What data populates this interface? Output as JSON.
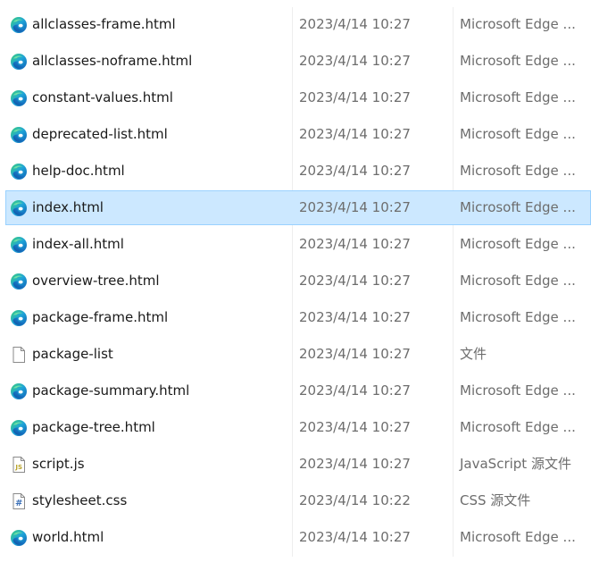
{
  "files": [
    {
      "name": "allclasses-frame.html",
      "modified": "2023/4/14 10:27",
      "type": "Microsoft Edge ...",
      "icon": "edge-icon",
      "selected": false
    },
    {
      "name": "allclasses-noframe.html",
      "modified": "2023/4/14 10:27",
      "type": "Microsoft Edge ...",
      "icon": "edge-icon",
      "selected": false
    },
    {
      "name": "constant-values.html",
      "modified": "2023/4/14 10:27",
      "type": "Microsoft Edge ...",
      "icon": "edge-icon",
      "selected": false
    },
    {
      "name": "deprecated-list.html",
      "modified": "2023/4/14 10:27",
      "type": "Microsoft Edge ...",
      "icon": "edge-icon",
      "selected": false
    },
    {
      "name": "help-doc.html",
      "modified": "2023/4/14 10:27",
      "type": "Microsoft Edge ...",
      "icon": "edge-icon",
      "selected": false
    },
    {
      "name": "index.html",
      "modified": "2023/4/14 10:27",
      "type": "Microsoft Edge ...",
      "icon": "edge-icon",
      "selected": true
    },
    {
      "name": "index-all.html",
      "modified": "2023/4/14 10:27",
      "type": "Microsoft Edge ...",
      "icon": "edge-icon",
      "selected": false
    },
    {
      "name": "overview-tree.html",
      "modified": "2023/4/14 10:27",
      "type": "Microsoft Edge ...",
      "icon": "edge-icon",
      "selected": false
    },
    {
      "name": "package-frame.html",
      "modified": "2023/4/14 10:27",
      "type": "Microsoft Edge ...",
      "icon": "edge-icon",
      "selected": false
    },
    {
      "name": "package-list",
      "modified": "2023/4/14 10:27",
      "type": "文件",
      "icon": "blank-file-icon",
      "selected": false
    },
    {
      "name": "package-summary.html",
      "modified": "2023/4/14 10:27",
      "type": "Microsoft Edge ...",
      "icon": "edge-icon",
      "selected": false
    },
    {
      "name": "package-tree.html",
      "modified": "2023/4/14 10:27",
      "type": "Microsoft Edge ...",
      "icon": "edge-icon",
      "selected": false
    },
    {
      "name": "script.js",
      "modified": "2023/4/14 10:27",
      "type": "JavaScript 源文件",
      "icon": "js-file-icon",
      "selected": false
    },
    {
      "name": "stylesheet.css",
      "modified": "2023/4/14 10:22",
      "type": "CSS 源文件",
      "icon": "css-file-icon",
      "selected": false
    },
    {
      "name": "world.html",
      "modified": "2023/4/14 10:27",
      "type": "Microsoft Edge ...",
      "icon": "edge-icon",
      "selected": false
    }
  ],
  "colors": {
    "selection_background": "#cce8ff",
    "selection_border": "#99d1ff",
    "name_text": "#1a1a1a",
    "detail_text": "#6d6d6d"
  }
}
